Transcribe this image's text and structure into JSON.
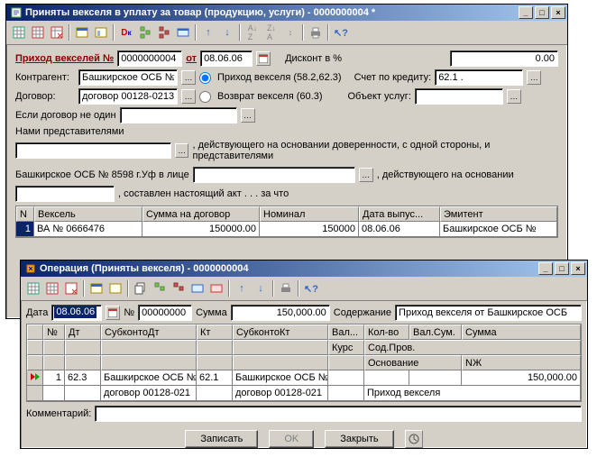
{
  "win1": {
    "title": "Приняты векселя в уплату за товар (продукцию, услуги) - 0000000004 *",
    "header": {
      "prihod_label": "Приход векселей №",
      "number": "0000000004",
      "ot_label": "от",
      "date": "08.06.06",
      "discount_label": "Дисконт в %",
      "discount": "0.00"
    },
    "f": {
      "kontr_label": "Контрагент:",
      "kontr": "Башкирское ОСБ №",
      "radio1": "Приход векселя (58.2,62.3)",
      "radio2": "Возврат векселя (60.3)",
      "schet_label": "Счет по кредиту:",
      "schet": "62.1 .",
      "dogovor_label": "Договор:",
      "dogovor": "договор 00128-0213",
      "obj_label": "Объект услуг:",
      "obj": "",
      "esli_label": "Если договор не один",
      "esli": "",
      "nami_label": "Нами представителями",
      "nami": "",
      "deist1": ", действующего на основании доверенности, с одной стороны, и представителями",
      "bank_line": "Башкирское ОСБ № 8598 г.Уф в лице",
      "bank_val": "",
      "deist2": ", действующего на основании",
      "sostav": ", составлен настоящий акт . . . за что",
      "sostav_val": ""
    },
    "grid": {
      "cols": [
        "N",
        "Вексель",
        "Сумма на договор",
        "Номинал",
        "Дата выпус...",
        "Эмитент"
      ],
      "row": [
        "1",
        "ВА № 0666476",
        "150000.00",
        "150000",
        "08.06.06",
        "Башкирское ОСБ №"
      ]
    }
  },
  "win2": {
    "title": "Операция (Приняты векселя) - 0000000004",
    "hdr": {
      "date_label": "Дата",
      "date": "08.06.06",
      "num_label": "№",
      "number": "00000000",
      "sum_label": "Сумма",
      "sum": "150,000.00",
      "cont_label": "Содержание",
      "cont": "Приход векселя от Башкирское ОСБ"
    },
    "grid": {
      "h1": [
        "",
        "№",
        "Дт",
        "СубконтоДт",
        "Кт",
        "СубконтоКт",
        "Вал...",
        "Кол-во",
        "Вал.Сум.",
        "Сумма"
      ],
      "h2_kurs": "Курс",
      "h2_sod": "Сод.Пров.",
      "h3_osn": "Основание",
      "h3_nzh": "NЖ",
      "r1": [
        "",
        "1",
        "62.3",
        "Башкирское ОСБ №",
        "62.1",
        "Башкирское ОСБ №",
        "",
        "",
        "",
        "150,000.00"
      ],
      "r2_dt": "договор 00128-021",
      "r2_kt": "договор 00128-021",
      "r2_sod": "Приход векселя"
    },
    "comment_label": "Комментарий:",
    "comment": "",
    "footer": {
      "save": "Записать",
      "ok": "OK",
      "close": "Закрыть"
    }
  }
}
